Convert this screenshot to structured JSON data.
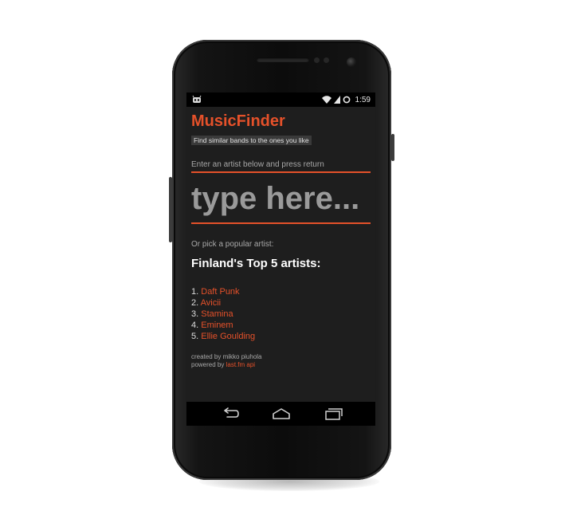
{
  "status_bar": {
    "time": "1:59",
    "left_icon": "android-notification-icon",
    "icons": [
      "wifi-icon",
      "signal-icon",
      "sync-icon"
    ]
  },
  "app": {
    "title": "MusicFinder",
    "subtitle": "Find similar bands to the ones you like",
    "prompt": "Enter an artist below and press return",
    "search_placeholder": "type here...",
    "or_text": "Or pick a popular artist:",
    "top_title": "Finland's Top 5 artists:",
    "artists": [
      {
        "num": "1.",
        "name": "Daft Punk"
      },
      {
        "num": "2.",
        "name": "Avicii"
      },
      {
        "num": "3.",
        "name": "Stamina"
      },
      {
        "num": "4.",
        "name": "Eminem"
      },
      {
        "num": "5.",
        "name": "Ellie Goulding"
      }
    ],
    "credit_line1": "created by mikko piuhola",
    "credit_powered": "powered by",
    "credit_link": "last.fm api"
  },
  "nav_bar": {
    "buttons": [
      "back-icon",
      "home-icon",
      "recents-icon"
    ]
  },
  "colors": {
    "accent": "#e5512a",
    "screen_bg": "#1e1e1e",
    "text_muted": "#a8a8a8"
  }
}
